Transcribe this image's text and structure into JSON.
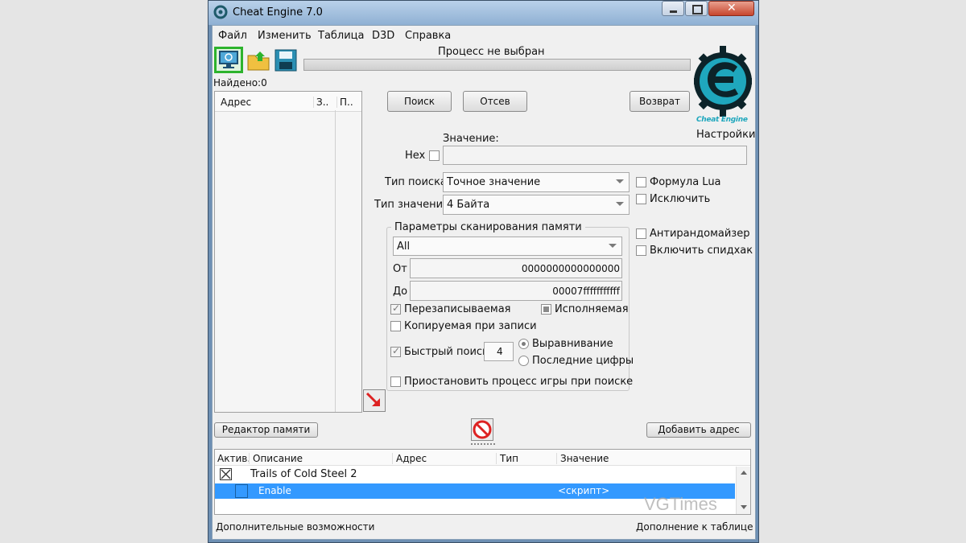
{
  "window": {
    "title": "Cheat Engine 7.0"
  },
  "menu": [
    "Файл",
    "Изменить",
    "Таблица",
    "D3D",
    "Справка"
  ],
  "toolbar": {
    "process_label": "Процесс не выбран",
    "found_label": "Найдено:0"
  },
  "results_list": {
    "columns": [
      "Адрес",
      "З..",
      "П.."
    ]
  },
  "scan": {
    "search_btn": "Поиск",
    "reset_btn": "Отсев",
    "return_btn": "Возврат",
    "value_label": "Значение:",
    "hex_label": "Hex",
    "settings_label": "Настройки",
    "search_type_label": "Тип поиска",
    "search_type_value": "Точное значение",
    "value_type_label": "Тип значения",
    "value_type_value": "4 Байта",
    "lua_label": "Формула Lua",
    "exclude_label": "Исключить",
    "antirandom_label": "Антирандомайзер",
    "speedhack_label": "Включить спидхак"
  },
  "mem_params": {
    "legend": "Параметры сканирования памяти",
    "region_value": "All",
    "from_label": "От",
    "from_value": "0000000000000000",
    "to_label": "До",
    "to_value": "00007fffffffffff",
    "writable_label": "Перезаписываемая",
    "executable_label": "Исполняемая",
    "copyonwrite_label": "Копируемая при записи",
    "fastscan_label": "Быстрый поиск",
    "fastscan_value": "4",
    "alignment_label": "Выравнивание",
    "lastdigits_label": "Последние цифры",
    "pause_label": "Приостановить процесс игры при поиске"
  },
  "actions": {
    "memory_editor_btn": "Редактор памяти",
    "add_address_btn": "Добавить адрес"
  },
  "address_table": {
    "columns": [
      "Актив.",
      "Описание",
      "Адрес",
      "Тип",
      "Значение"
    ],
    "rows": [
      {
        "description": "Trails of Cold Steel 2",
        "value": ""
      },
      {
        "description": "Enable",
        "value": "<скрипт>"
      }
    ]
  },
  "statusbar": {
    "left": "Дополнительные возможности",
    "right": "Дополнение к таблице"
  },
  "watermark": "VGTimes",
  "logo": {
    "text": "Cheat Engine"
  },
  "colors": {
    "selection": "#3399ff",
    "logo_teal": "#2aa3b5",
    "titlebar": "#a9c4e2"
  }
}
